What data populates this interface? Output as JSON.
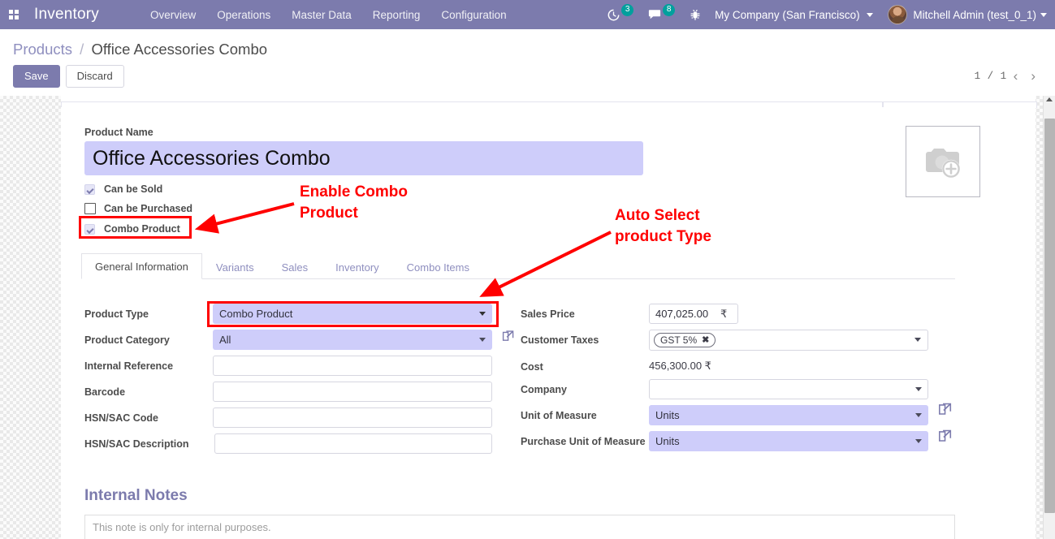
{
  "navbar": {
    "apps_icon": "apps-grid-icon",
    "brand": "Inventory",
    "menus": [
      {
        "label": "Overview"
      },
      {
        "label": "Operations"
      },
      {
        "label": "Master Data"
      },
      {
        "label": "Reporting"
      },
      {
        "label": "Configuration"
      }
    ],
    "activities": {
      "icon": "clock-icon",
      "count": "3"
    },
    "messages": {
      "icon": "chat-bubble-icon",
      "count": "8"
    },
    "debug": {
      "icon": "bug-icon"
    },
    "company": "My Company (San Francisco)",
    "user": "Mitchell Admin (test_0_1)",
    "accent": "#7c7bad",
    "badge_color": "#00a09d"
  },
  "control_panel": {
    "breadcrumb_root": "Products",
    "breadcrumb_sep": "/",
    "breadcrumb_current": "Office Accessories Combo",
    "save_label": "Save",
    "discard_label": "Discard",
    "pager_count": "1 / 1",
    "pager_prev": "‹",
    "pager_next": "›"
  },
  "form": {
    "product_name_label": "Product Name",
    "product_name_value": "Office Accessories Combo",
    "product_name_bg": "#cecdfa",
    "image_placeholder_icon": "camera-add-icon",
    "checkboxes": [
      {
        "label": "Can be Sold",
        "checked": true
      },
      {
        "label": "Can be Purchased",
        "checked": false
      },
      {
        "label": "Combo Product",
        "checked": true,
        "highlighted": true
      }
    ],
    "tabs": [
      {
        "label": "General Information",
        "active": true
      },
      {
        "label": "Variants",
        "active": false
      },
      {
        "label": "Sales",
        "active": false
      },
      {
        "label": "Inventory",
        "active": false
      },
      {
        "label": "Combo Items",
        "active": false
      }
    ],
    "left_fields": {
      "product_type": {
        "label": "Product Type",
        "value": "Combo Product",
        "highlighted": true
      },
      "product_category": {
        "label": "Product Category",
        "value": "All",
        "ext_link_icon": "external-link-icon"
      },
      "internal_reference": {
        "label": "Internal Reference",
        "value": ""
      },
      "barcode": {
        "label": "Barcode",
        "value": ""
      },
      "hsn_sac_code": {
        "label": "HSN/SAC Code",
        "value": ""
      },
      "hsn_sac_description": {
        "label": "HSN/SAC Description",
        "value": ""
      }
    },
    "right_fields": {
      "sales_price": {
        "label": "Sales Price",
        "value": "407,025.00",
        "currency": "₹"
      },
      "customer_taxes": {
        "label": "Customer Taxes",
        "tag": "GST 5%",
        "tag_remove": "✖"
      },
      "cost": {
        "label": "Cost",
        "value": "456,300.00 ₹"
      },
      "company": {
        "label": "Company",
        "value": ""
      },
      "unit_of_measure": {
        "label": "Unit of Measure",
        "value": "Units",
        "ext_link_icon": "external-link-icon"
      },
      "purchase_unit_of_measure": {
        "label": "Purchase Unit of Measure",
        "value": "Units",
        "ext_link_icon": "external-link-icon"
      }
    },
    "notes": {
      "title": "Internal Notes",
      "placeholder": "This note is only for internal purposes."
    }
  },
  "annotations": {
    "color": "#ff0000",
    "enable_combo": "Enable Combo\nProduct",
    "auto_select": "Auto Select\nproduct Type"
  }
}
